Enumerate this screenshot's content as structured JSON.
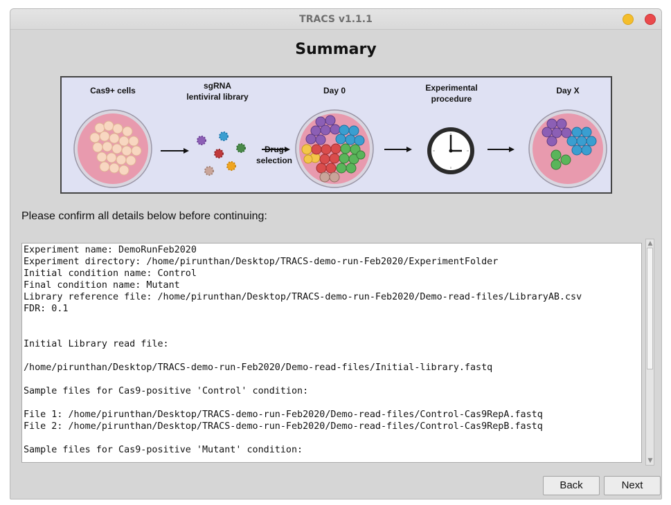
{
  "window": {
    "title": "TRACS v1.1.1"
  },
  "page": {
    "heading": "Summary",
    "prompt": "Please confirm all details below before continuing:"
  },
  "diagram": {
    "labels": {
      "cas9": "Cas9+ cells",
      "sgrna": "sgRNA\nlentiviral library",
      "drug": "Drug\nselection",
      "day0": "Day 0",
      "procedure": "Experimental\nprocedure",
      "dayx": "Day X"
    },
    "colors": {
      "dish": "#e89aae",
      "purple": "#8c5fb5",
      "blue": "#3a9ed0",
      "red": "#d94c4c",
      "green": "#5ab55a",
      "yellow": "#f4c64a",
      "peach": "#f8d7c1"
    }
  },
  "summary": {
    "text": "Experiment name: DemoRunFeb2020\nExperiment directory: /home/pirunthan/Desktop/TRACS-demo-run-Feb2020/ExperimentFolder\nInitial condition name: Control\nFinal condition name: Mutant\nLibrary reference file: /home/pirunthan/Desktop/TRACS-demo-run-Feb2020/Demo-read-files/LibraryAB.csv\nFDR: 0.1\n\n\nInitial Library read file:\n\n/home/pirunthan/Desktop/TRACS-demo-run-Feb2020/Demo-read-files/Initial-library.fastq\n\nSample files for Cas9-positive 'Control' condition:\n\nFile 1: /home/pirunthan/Desktop/TRACS-demo-run-Feb2020/Demo-read-files/Control-Cas9RepA.fastq\nFile 2: /home/pirunthan/Desktop/TRACS-demo-run-Feb2020/Demo-read-files/Control-Cas9RepB.fastq\n\nSample files for Cas9-positive 'Mutant' condition:"
  },
  "buttons": {
    "back": "Back",
    "next": "Next"
  }
}
